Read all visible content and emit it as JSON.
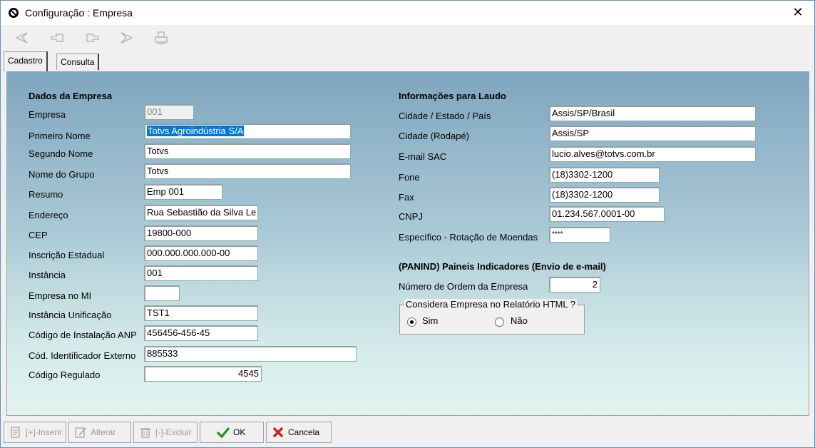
{
  "window": {
    "title": "Configuração : Empresa",
    "close_glyph": "✕"
  },
  "toolbar": {
    "icons": [
      "first-record-icon",
      "previous-record-icon",
      "next-record-icon",
      "last-record-icon",
      "print-icon"
    ]
  },
  "tabs": [
    {
      "label": "Cadastro",
      "active": true
    },
    {
      "label": "Consulta",
      "active": false
    }
  ],
  "empresa": {
    "section_title": "Dados da Empresa",
    "fields": {
      "empresa": {
        "label": "Empresa",
        "value": "001"
      },
      "primeiro_nome": {
        "label": "Primeiro Nome",
        "value": "Totvs Agroindústria S/A"
      },
      "segundo_nome": {
        "label": "Segundo Nome",
        "value": "Totvs"
      },
      "nome_grupo": {
        "label": "Nome do Grupo",
        "value": "Totvs"
      },
      "resumo": {
        "label": "Resumo",
        "value": "Emp 001"
      },
      "endereco": {
        "label": "Endereço",
        "value": "Rua Sebastião da Silva Le"
      },
      "cep": {
        "label": "CEP",
        "value": "19800-000"
      },
      "inscricao_estadual": {
        "label": "Inscrição Estadual",
        "value": "000.000.000.000-00"
      },
      "instancia": {
        "label": "Instância",
        "value": "001"
      },
      "empresa_mi": {
        "label": "Empresa no MI",
        "value": ""
      },
      "instancia_unificacao": {
        "label": "Instância Unificação",
        "value": "TST1"
      },
      "codigo_anp": {
        "label": "Código de Instalação ANP",
        "value": "456456-456-45"
      },
      "cod_externo": {
        "label": "Cód. Identificador Externo",
        "value": "885533"
      },
      "codigo_regulado": {
        "label": "Código Regulado",
        "value": "4545"
      }
    }
  },
  "laudo": {
    "section_title": "Informações para Laudo",
    "fields": {
      "cidade_estado_pais": {
        "label": "Cidade / Estado / País",
        "value": "Assis/SP/Brasil"
      },
      "cidade_rodape": {
        "label": "Cidade (Rodapé)",
        "value": "Assis/SP"
      },
      "email_sac": {
        "label": "E-mail SAC",
        "value": "lucio.alves@totvs.com.br"
      },
      "fone": {
        "label": "Fone",
        "value": "(18)3302-1200"
      },
      "fax": {
        "label": "Fax",
        "value": "(18)3302-1200"
      },
      "cnpj": {
        "label": "CNPJ",
        "value": "01.234.567.0001-00"
      },
      "especifico": {
        "label": "Específico - Rotação de Moendas",
        "value": "****"
      }
    }
  },
  "panind": {
    "section_title": "(PANIND) Paineis Indicadores (Envio de e-mail)",
    "ordem": {
      "label": "Número de Ordem da Empresa",
      "value": "2"
    },
    "group_title": "Considera Empresa no Relatório HTML ?",
    "option_sim": "Sim",
    "option_nao": "Não",
    "selected": "Sim"
  },
  "buttons": {
    "inserir": "[+]-Inserir",
    "alterar": "Alterar",
    "excluir": "[-]-Excluir",
    "ok": "OK",
    "cancela": "Cancela"
  },
  "colors": {
    "ok_green": "#1a9a1a",
    "cancel_red": "#d42020",
    "selection_blue": "#0078d7"
  }
}
